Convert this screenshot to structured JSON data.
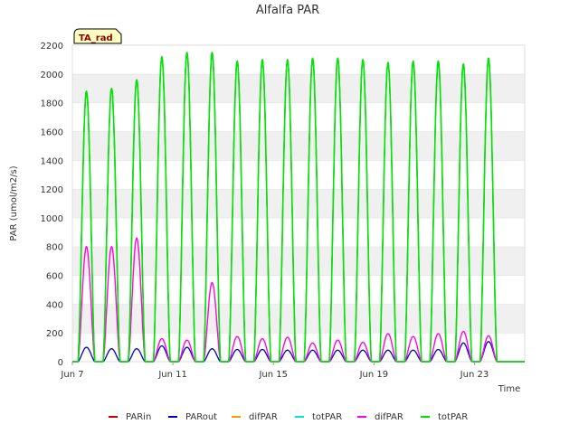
{
  "chart_data": {
    "type": "line",
    "title": "Alfalfa PAR",
    "xlabel": "Time",
    "ylabel": "PAR (umol/m2/s)",
    "badge": "TA_rad",
    "x_range": [
      "2024-06-07",
      "2024-06-25"
    ],
    "x_ticks": [
      {
        "date": "2024-06-07",
        "label": "Jun 7"
      },
      {
        "date": "2024-06-11",
        "label": "Jun 11"
      },
      {
        "date": "2024-06-15",
        "label": "Jun 15"
      },
      {
        "date": "2024-06-19",
        "label": "Jun 19"
      },
      {
        "date": "2024-06-23",
        "label": "Jun 23"
      }
    ],
    "ylim": [
      0,
      2200
    ],
    "y_ticks": [
      0,
      200,
      400,
      600,
      800,
      1000,
      1200,
      1400,
      1600,
      1800,
      2000,
      2200
    ],
    "grid": "horizontal bands",
    "legend_position": "bottom",
    "days": [
      "Jun 7",
      "Jun 8",
      "Jun 9",
      "Jun 10",
      "Jun 11",
      "Jun 12",
      "Jun 13",
      "Jun 14",
      "Jun 15",
      "Jun 16",
      "Jun 17",
      "Jun 18",
      "Jun 19",
      "Jun 20",
      "Jun 21",
      "Jun 22",
      "Jun 23",
      "Jun 24"
    ],
    "series": [
      {
        "name": "PARin",
        "color": "#cc0000",
        "values": [
          1880,
          1900,
          1960,
          2120,
          2150,
          2150,
          2090,
          2100,
          2100,
          2110,
          2110,
          2100,
          2080,
          2090,
          2090,
          2070,
          2110,
          0
        ]
      },
      {
        "name": "PARout",
        "color": "#0000cc",
        "values": [
          100,
          90,
          90,
          110,
          100,
          90,
          85,
          85,
          80,
          80,
          80,
          80,
          80,
          80,
          85,
          130,
          140,
          0
        ]
      },
      {
        "name": "difPAR",
        "color": "#ff9900",
        "values": [
          800,
          800,
          860,
          160,
          150,
          550,
          175,
          160,
          170,
          130,
          150,
          135,
          195,
          175,
          195,
          210,
          180,
          0
        ]
      },
      {
        "name": "totPAR",
        "color": "#00e5e5",
        "values": [
          1880,
          1900,
          1960,
          2120,
          2150,
          2150,
          2090,
          2100,
          2100,
          2110,
          2110,
          2100,
          2080,
          2090,
          2090,
          2070,
          2110,
          0
        ]
      },
      {
        "name": "difPAR",
        "color": "#ff00ff",
        "values": [
          800,
          800,
          860,
          160,
          150,
          550,
          175,
          160,
          170,
          130,
          150,
          135,
          195,
          175,
          195,
          210,
          180,
          0
        ]
      },
      {
        "name": "totPAR",
        "color": "#00e600",
        "values": [
          1880,
          1900,
          1960,
          2120,
          2150,
          2150,
          2090,
          2100,
          2100,
          2110,
          2110,
          2100,
          2080,
          2090,
          2090,
          2070,
          2110,
          0
        ]
      }
    ]
  }
}
